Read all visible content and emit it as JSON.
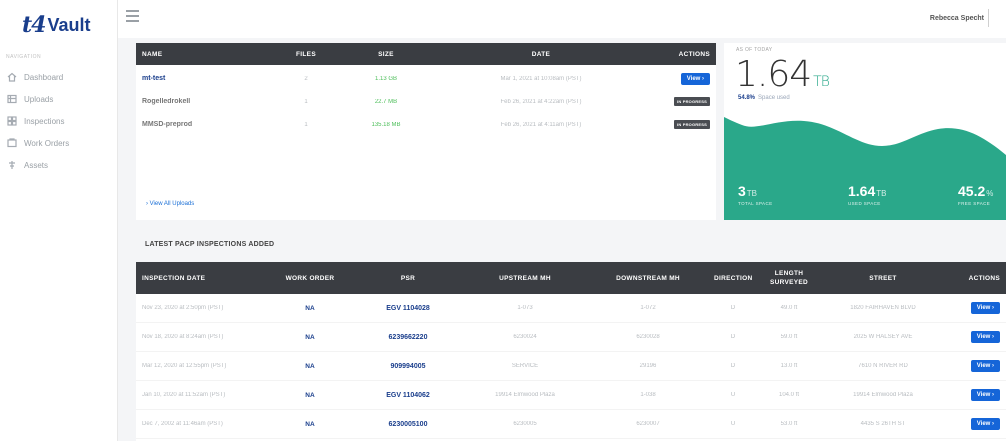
{
  "logo": {
    "mark": "t4",
    "text": "Vault"
  },
  "sidebar": {
    "section_label": "NAVIGATION",
    "items": [
      {
        "label": "Dashboard",
        "icon": "home-icon"
      },
      {
        "label": "Uploads",
        "icon": "uploads-icon"
      },
      {
        "label": "Inspections",
        "icon": "inspections-icon"
      },
      {
        "label": "Work Orders",
        "icon": "work-orders-icon"
      },
      {
        "label": "Assets",
        "icon": "assets-icon"
      }
    ]
  },
  "topbar": {
    "user_name": "Rebecca Specht"
  },
  "uploads": {
    "columns": [
      "NAME",
      "FILES",
      "SIZE",
      "DATE",
      "ACTIONS"
    ],
    "rows": [
      {
        "name": "mt-test",
        "files": "2",
        "size": "1.13 GB",
        "date": "Mar 1, 2021 at 10:08am (PST)",
        "action": "View ›",
        "action_type": "button"
      },
      {
        "name": "Rogelledrokell",
        "files": "1",
        "size": "22.7 MB",
        "date": "Feb 26, 2021 at 4:22am (PST)",
        "action": "IN PROGRESS",
        "action_type": "badge"
      },
      {
        "name": "MMSD-preprod",
        "files": "1",
        "size": "135.18 MB",
        "date": "Feb 26, 2021 at 4:11am (PST)",
        "action": "IN PROGRESS",
        "action_type": "badge"
      }
    ],
    "view_all": "› View All Uploads"
  },
  "storage": {
    "as_of": "AS OF TODAY",
    "used_value": "1.64",
    "used_unit": "TB",
    "percent_used": "54.8%",
    "percent_label": "Space used",
    "used_fraction": 0.548,
    "stats": [
      {
        "value": "3",
        "unit": "TB",
        "label": "TOTAL SPACE"
      },
      {
        "value": "1.64",
        "unit": "TB",
        "label": "USED SPACE"
      },
      {
        "value": "45.2",
        "unit": "%",
        "label": "FREE SPACE"
      }
    ],
    "colors": {
      "accent": "#2aa88a"
    }
  },
  "inspections": {
    "title": "LATEST PACP INSPECTIONS ADDED",
    "columns": [
      "INSPECTION DATE",
      "WORK ORDER",
      "PSR",
      "UPSTREAM MH",
      "DOWNSTREAM MH",
      "DIRECTION",
      "LENGTH SURVEYED",
      "STREET",
      "ACTIONS"
    ],
    "rows": [
      {
        "date": "Nov 23, 2020 at 2:50pm (PST)",
        "work_order": "NA",
        "psr": "EGV 1104028",
        "upstream": "1-073",
        "downstream": "1-072",
        "direction": "D",
        "length": "49.0 ft",
        "street": "1820 FAIRHAVEN BLVD",
        "action": "View ›"
      },
      {
        "date": "Nov 18, 2020 at 8:24am (PST)",
        "work_order": "NA",
        "psr": "6239662220",
        "upstream": "6230024",
        "downstream": "6230028",
        "direction": "D",
        "length": "59.0 ft",
        "street": "2025 W HALSEY AVE",
        "action": "View ›"
      },
      {
        "date": "Mar 12, 2020 at 12:55pm (PST)",
        "work_order": "NA",
        "psr": "909994005",
        "upstream": "SERVICE",
        "downstream": "29196",
        "direction": "D",
        "length": "13.0 ft",
        "street": "7610 N RIVER RD",
        "action": "View ›"
      },
      {
        "date": "Jan 10, 2020 at 11:52am (PST)",
        "work_order": "NA",
        "psr": "EGV 1104062",
        "upstream": "19914 Elmwood Plaza",
        "downstream": "1-038",
        "direction": "U",
        "length": "104.0 ft",
        "street": "19914 Elmwood Plaza",
        "action": "View ›"
      },
      {
        "date": "Dec 7, 2002 at 11:46am (PST)",
        "work_order": "NA",
        "psr": "6230005100",
        "upstream": "6230005",
        "downstream": "6230007",
        "direction": "U",
        "length": "53.0 ft",
        "street": "4435 S 26TH ST",
        "action": "View ›"
      }
    ]
  }
}
